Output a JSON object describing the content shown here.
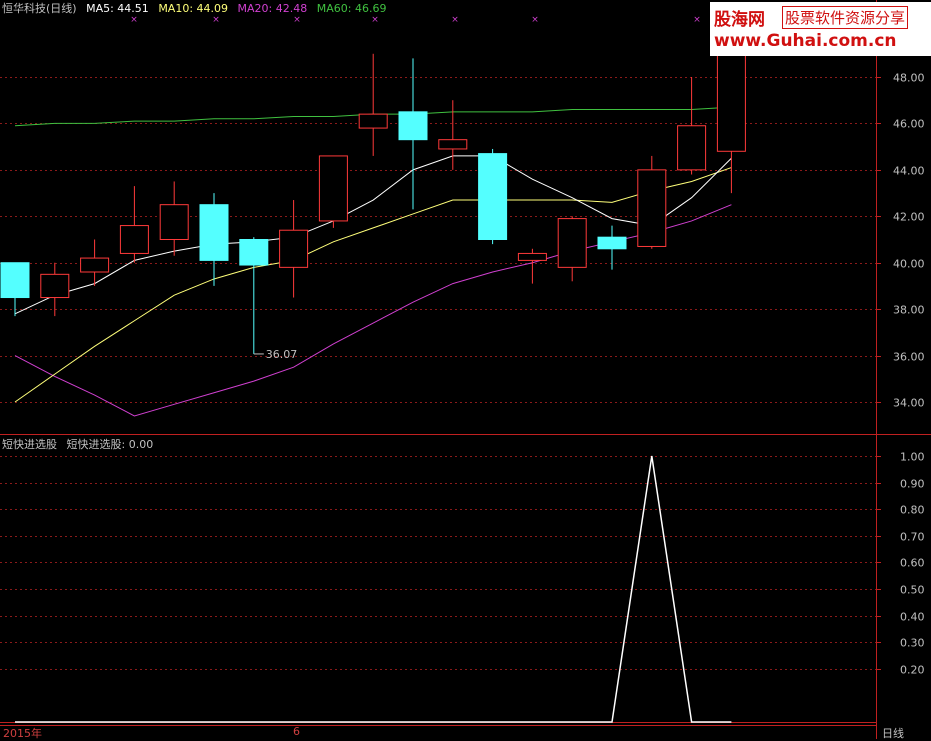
{
  "header": {
    "name": "恒华科技(日线)",
    "ma5": "MA5: 44.51",
    "ma10": "MA10: 44.09",
    "ma20": "MA20: 42.48",
    "ma60": "MA60: 46.69"
  },
  "indicator_header": {
    "name": "短快进选股",
    "value": "短快进选股: 0.00"
  },
  "watermark": {
    "line1": "股海网",
    "line2": "股票软件资源分享",
    "line3": "www.Guhai.com.cn"
  },
  "x_labels": [
    "2015年",
    "6"
  ],
  "period_button": "日线",
  "colors": {
    "up": "#ff3a3a",
    "down": "#54ffff",
    "ma5": "#ffffff",
    "ma10": "#ffff7a",
    "ma20": "#d040d0",
    "ma60": "#40c040",
    "grid": "#8b1a1a",
    "axis": "#c02020"
  },
  "chart_data": [
    {
      "type": "candlestick",
      "yticks": [
        "34.00",
        "36.00",
        "38.00",
        "40.00",
        "42.00",
        "44.00",
        "46.00",
        "48.00"
      ],
      "ylim": [
        33,
        50.5
      ],
      "low_annotation": "36.07",
      "candles": [
        {
          "o": 40.0,
          "h": 40.0,
          "l": 37.7,
          "c": 38.5
        },
        {
          "o": 38.5,
          "h": 40.0,
          "l": 37.7,
          "c": 39.5
        },
        {
          "o": 39.6,
          "h": 41.0,
          "l": 39.0,
          "c": 40.2
        },
        {
          "o": 40.4,
          "h": 43.3,
          "l": 40.0,
          "c": 41.6
        },
        {
          "o": 41.0,
          "h": 43.5,
          "l": 40.3,
          "c": 42.5
        },
        {
          "o": 42.5,
          "h": 43.0,
          "l": 39.0,
          "c": 40.1
        },
        {
          "o": 41.0,
          "h": 41.1,
          "l": 36.07,
          "c": 39.9
        },
        {
          "o": 39.8,
          "h": 42.7,
          "l": 38.5,
          "c": 41.4
        },
        {
          "o": 41.8,
          "h": 44.6,
          "l": 41.5,
          "c": 44.6
        },
        {
          "o": 45.8,
          "h": 49.0,
          "l": 44.6,
          "c": 46.4
        },
        {
          "o": 46.5,
          "h": 48.8,
          "l": 42.3,
          "c": 45.3
        },
        {
          "o": 44.9,
          "h": 47.0,
          "l": 44.0,
          "c": 45.3
        },
        {
          "o": 44.7,
          "h": 44.9,
          "l": 40.8,
          "c": 41.0
        },
        {
          "o": 40.1,
          "h": 40.6,
          "l": 39.1,
          "c": 40.4
        },
        {
          "o": 39.8,
          "h": 42.0,
          "l": 39.2,
          "c": 41.9
        },
        {
          "o": 41.1,
          "h": 41.6,
          "l": 39.7,
          "c": 40.6
        },
        {
          "o": 40.7,
          "h": 44.6,
          "l": 40.6,
          "c": 44.0
        },
        {
          "o": 44.0,
          "h": 48.0,
          "l": 43.8,
          "c": 45.9
        },
        {
          "o": 44.8,
          "h": 50.5,
          "l": 43.0,
          "c": 50.5
        }
      ],
      "ma5": [
        37.8,
        38.6,
        39.1,
        40.1,
        40.5,
        40.8,
        40.9,
        41.1,
        41.8,
        42.7,
        44.0,
        44.6,
        44.6,
        43.6,
        42.8,
        41.9,
        41.6,
        42.8,
        44.5
      ],
      "ma10": [
        34.0,
        35.2,
        36.4,
        37.5,
        38.6,
        39.3,
        39.8,
        40.1,
        40.9,
        41.5,
        42.1,
        42.7,
        42.7,
        42.7,
        42.7,
        42.6,
        43.1,
        43.5,
        44.1
      ],
      "ma20": [
        36.0,
        35.1,
        34.3,
        33.4,
        33.9,
        34.4,
        34.9,
        35.5,
        36.5,
        37.4,
        38.3,
        39.1,
        39.6,
        40.0,
        40.5,
        40.9,
        41.3,
        41.8,
        42.5
      ],
      "ma60": [
        45.9,
        46.0,
        46.0,
        46.1,
        46.1,
        46.2,
        46.2,
        46.3,
        46.3,
        46.4,
        46.4,
        46.5,
        46.5,
        46.5,
        46.6,
        46.6,
        46.6,
        46.6,
        46.7
      ]
    },
    {
      "type": "line",
      "yticks": [
        "0.20",
        "0.30",
        "0.40",
        "0.50",
        "0.60",
        "0.70",
        "0.80",
        "0.90",
        "1.00"
      ],
      "ylim": [
        0,
        1.0
      ],
      "values": [
        0,
        0,
        0,
        0,
        0,
        0,
        0,
        0,
        0,
        0,
        0,
        0,
        0,
        0,
        0,
        0,
        1,
        0,
        0
      ]
    }
  ]
}
